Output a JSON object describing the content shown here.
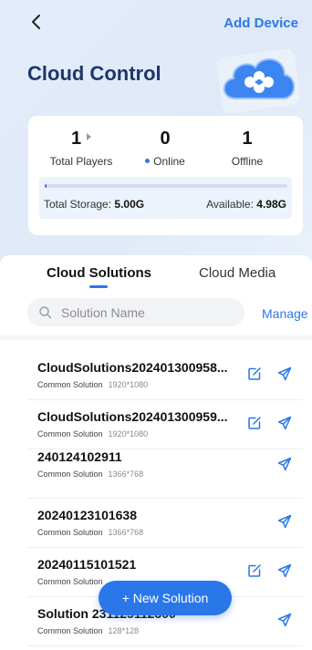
{
  "header": {
    "add_device": "Add Device",
    "title": "Cloud Control"
  },
  "stats": {
    "total_players": {
      "value": "1",
      "label": "Total Players"
    },
    "online": {
      "value": "0",
      "label": "Online"
    },
    "offline": {
      "value": "1",
      "label": "Offline"
    }
  },
  "storage": {
    "total_label": "Total Storage:",
    "total_value": "5.00G",
    "available_label": "Available:",
    "available_value": "4.98G",
    "used_fraction": 0.004
  },
  "tabs": [
    {
      "label": "Cloud Solutions"
    },
    {
      "label": "Cloud Media"
    }
  ],
  "search": {
    "placeholder": "Solution Name",
    "value": ""
  },
  "manage_label": "Manage",
  "solutions": [
    {
      "name": "CloudSolutions202401300958...",
      "type": "Common Solution",
      "resolution": "1920*1080",
      "editable": true
    },
    {
      "name": "CloudSolutions202401300959...",
      "type": "Common Solution",
      "resolution": "1920*1080",
      "editable": true
    },
    {
      "name": "240124102911",
      "type": "Common Solution",
      "resolution": "1366*768",
      "editable": false
    },
    {
      "name": "20240123101638",
      "type": "Common Solution",
      "resolution": "1366*768",
      "editable": false
    },
    {
      "name": "20240115101521",
      "type": "Common Solution",
      "resolution": "",
      "editable": true
    },
    {
      "name": "Solution 231125112300",
      "type": "Common Solution",
      "resolution": "128*128",
      "editable": false
    }
  ],
  "fab_label": "+ New Solution",
  "colors": {
    "accent": "#2a77ea",
    "title": "#1d3768"
  }
}
